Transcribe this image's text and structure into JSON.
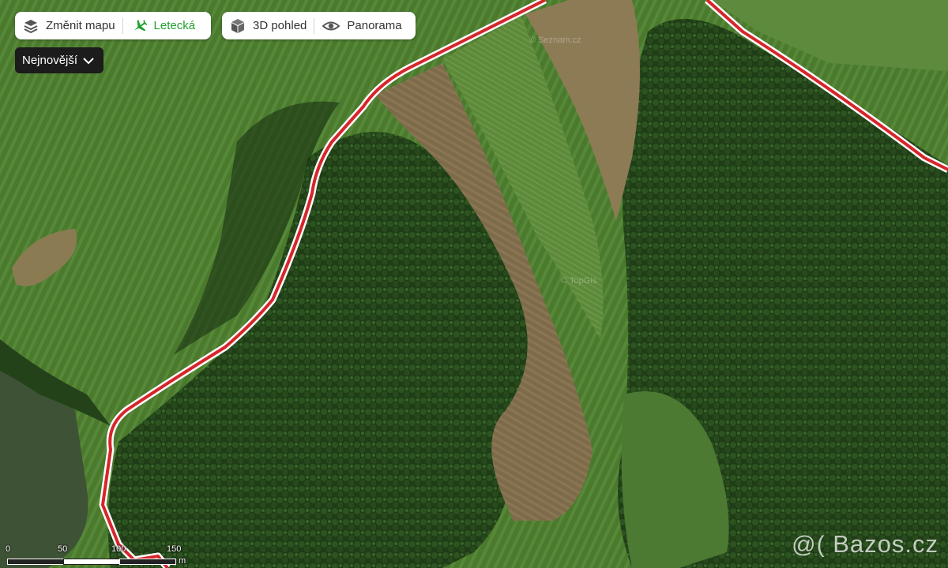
{
  "toolbar_left": {
    "change_map_label": "Změnit mapu",
    "aerial_label": "Letecká"
  },
  "toolbar_right": {
    "view_3d_label": "3D pohled",
    "panorama_label": "Panorama"
  },
  "sort_dropdown": {
    "selected": "Nejnovější"
  },
  "scale": {
    "ticks": [
      "0",
      "50",
      "100",
      "150"
    ],
    "unit": "m"
  },
  "watermark": {
    "prefix": "@(",
    "text": "Bazos.cz"
  },
  "attribution": {
    "seznam": "© Seznam.cz",
    "topgis": "© TopGis"
  },
  "colors": {
    "accent_green": "#21a02e",
    "boundary_red": "#d6262b",
    "dropdown_bg": "#1c1c1c"
  },
  "icons": {
    "change_map": "layers-icon",
    "aerial": "plane-icon",
    "view_3d": "cube-icon",
    "panorama": "eye-icon",
    "dropdown": "chevron-down-icon"
  }
}
